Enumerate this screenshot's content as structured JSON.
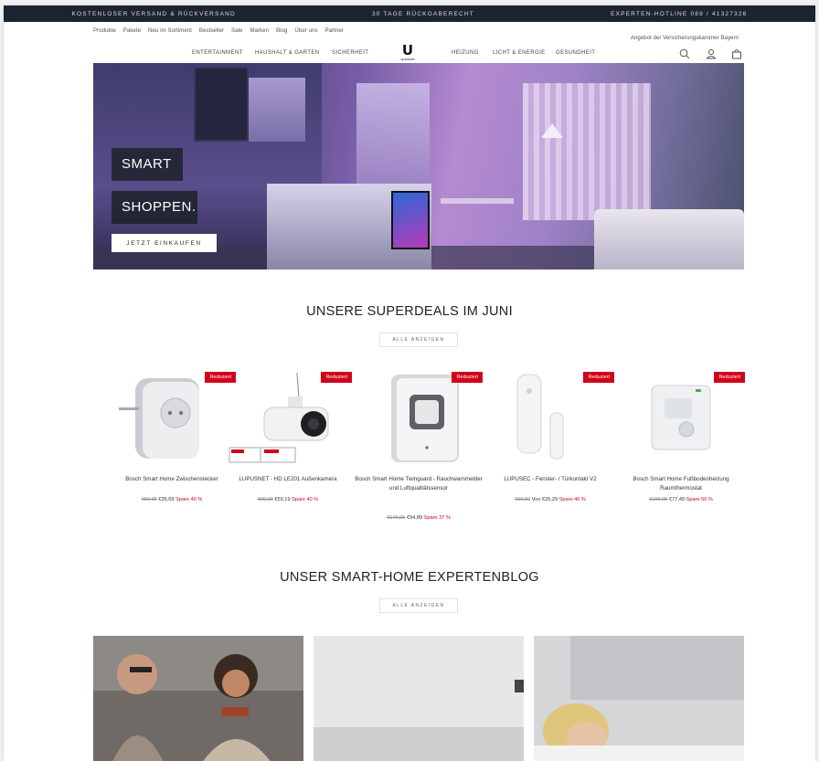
{
  "topbar": {
    "items": [
      "KOSTENLOSER VERSAND & RÜCKVERSAND",
      "30 TAGE RÜCKGABERECHT",
      "EXPERTEN-HOTLINE 089 / 41327326"
    ]
  },
  "subnav": {
    "links": [
      "Produkte",
      "Pakete",
      "Neu im Sortiment",
      "Bestseller",
      "Sale",
      "Marken",
      "Blog",
      "Über uns",
      "Partner"
    ],
    "right_link": "Angebot der Versicherungskammer Bayern"
  },
  "mainnav": {
    "left": [
      "ENTERTAINMENT",
      "HAUSHALT & GARTEN",
      "SICHERHEIT"
    ],
    "right": [
      "HEIZUNG",
      "LICHT & ENERGIE",
      "GESUNDHEIT"
    ],
    "logo_letter": "U",
    "logo_word": "uptodate"
  },
  "hero": {
    "line1": "SMART",
    "line2": "SHOPPEN.",
    "cta": "JETZT EINKAUFEN"
  },
  "deals": {
    "title": "UNSERE SUPERDEALS IM JUNI",
    "all_label": "ALLE ANZEIGEN",
    "badge": "Reduziert",
    "products": [
      {
        "name": "Bosch Smart Home Zwischenstecker",
        "old": "€59,95",
        "price": "€35,69",
        "save": "Spare 40 %"
      },
      {
        "name": "LUPUSNET - HD LE201 Außenkamera",
        "old": "€99,00",
        "price": "€59,19",
        "save": "Spare 40 %"
      },
      {
        "name": "Bosch Smart Home Twinguard - Rauchwarnmelder und Luftqualitätssensor",
        "old": "€149,95",
        "price": "€94,89",
        "save": "Spare 37 %"
      },
      {
        "name": "LUPUSEC - Fenster- / Türkontakt V2",
        "old": "€59,00",
        "price": "Von €35,29",
        "save": "Spare 40 %"
      },
      {
        "name": "Bosch Smart Home Fußbodenheizung Raumthermostat",
        "old": "€155,95",
        "price": "€77,49",
        "save": "Spare 50 %"
      }
    ]
  },
  "blog": {
    "title": "UNSER SMART-HOME EXPERTENBLOG",
    "all_label": "ALLE ANZEIGEN"
  },
  "colors": {
    "topbar": "#1b2430",
    "badge": "#d0021b"
  },
  "icons": [
    "search-icon",
    "account-icon",
    "cart-icon"
  ]
}
